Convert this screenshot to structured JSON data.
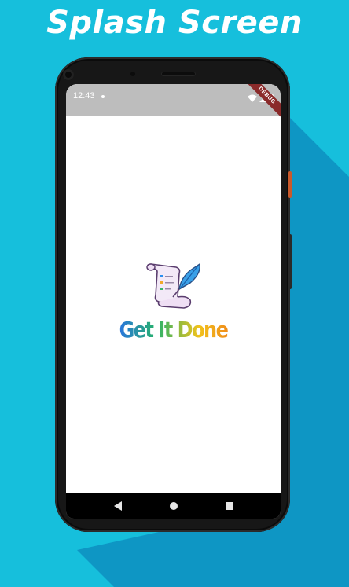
{
  "headline": "Splash Screen",
  "status_bar": {
    "time": "12:43",
    "debug_banner": "DEBUG"
  },
  "app": {
    "name": "Get It Done",
    "logo_icon": "scroll-and-quill-icon"
  },
  "nav_bar": {
    "back_icon": "back-triangle-icon",
    "home_icon": "home-circle-icon",
    "recents_icon": "recents-square-icon"
  },
  "colors": {
    "background": "#16bfdc",
    "shadow": "#0e96c4",
    "phone_body": "#171717",
    "status_bar": "#bdbdbd",
    "screen": "#ffffff",
    "nav_bar": "#000000",
    "debug_ribbon": "#8a2a2a"
  }
}
